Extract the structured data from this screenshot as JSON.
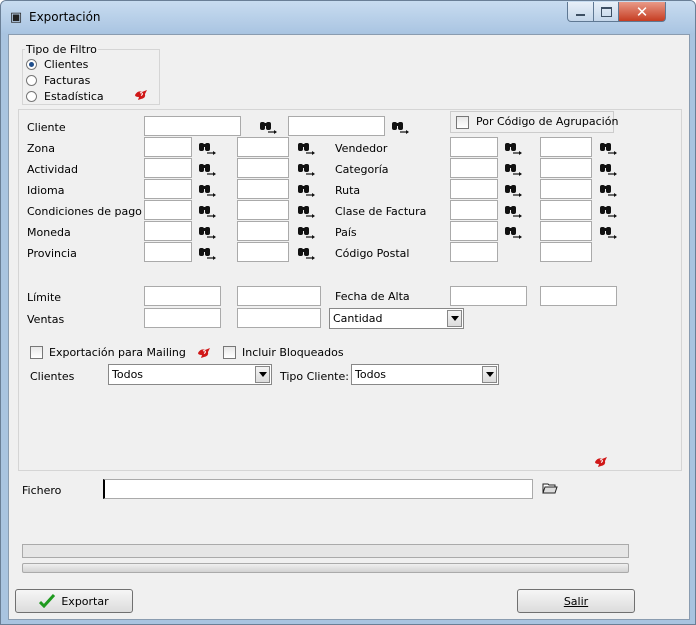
{
  "window": {
    "title": "Exportación",
    "close_glyph": "✕"
  },
  "filter": {
    "legend": "Tipo de Filtro",
    "options": [
      "Clientes",
      "Facturas",
      "Estadística"
    ],
    "selected": "Clientes"
  },
  "fields": {
    "cliente": "Cliente",
    "zona": "Zona",
    "actividad": "Actividad",
    "idioma": "Idioma",
    "condiciones": "Condiciones de pago",
    "moneda": "Moneda",
    "provincia": "Provincia",
    "vendedor": "Vendedor",
    "categoria": "Categoría",
    "ruta": "Ruta",
    "clase_factura": "Clase de Factura",
    "pais": "País",
    "codigo_postal": "Código Postal",
    "limite": "Límite",
    "ventas": "Ventas",
    "fecha_alta": "Fecha de Alta"
  },
  "agrupacion_label": "Por Código de Agrupación",
  "ventas_combo": "Cantidad",
  "mailing_label": "Exportación para Mailing",
  "bloqueados_label": "Incluir Bloqueados",
  "clientes_label": "Clientes",
  "clientes_combo": "Todos",
  "tipo_cliente_label": "Tipo Cliente:",
  "tipo_cliente_combo": "Todos",
  "fichero_label": "Fichero",
  "fichero_value": "",
  "buttons": {
    "exportar": "Exportar",
    "salir": "Salir"
  },
  "icons": {
    "binoculars": "binoculars-arrow-icon",
    "help": "help-icon",
    "folder": "open-folder-icon",
    "check": "checkmark-icon"
  }
}
